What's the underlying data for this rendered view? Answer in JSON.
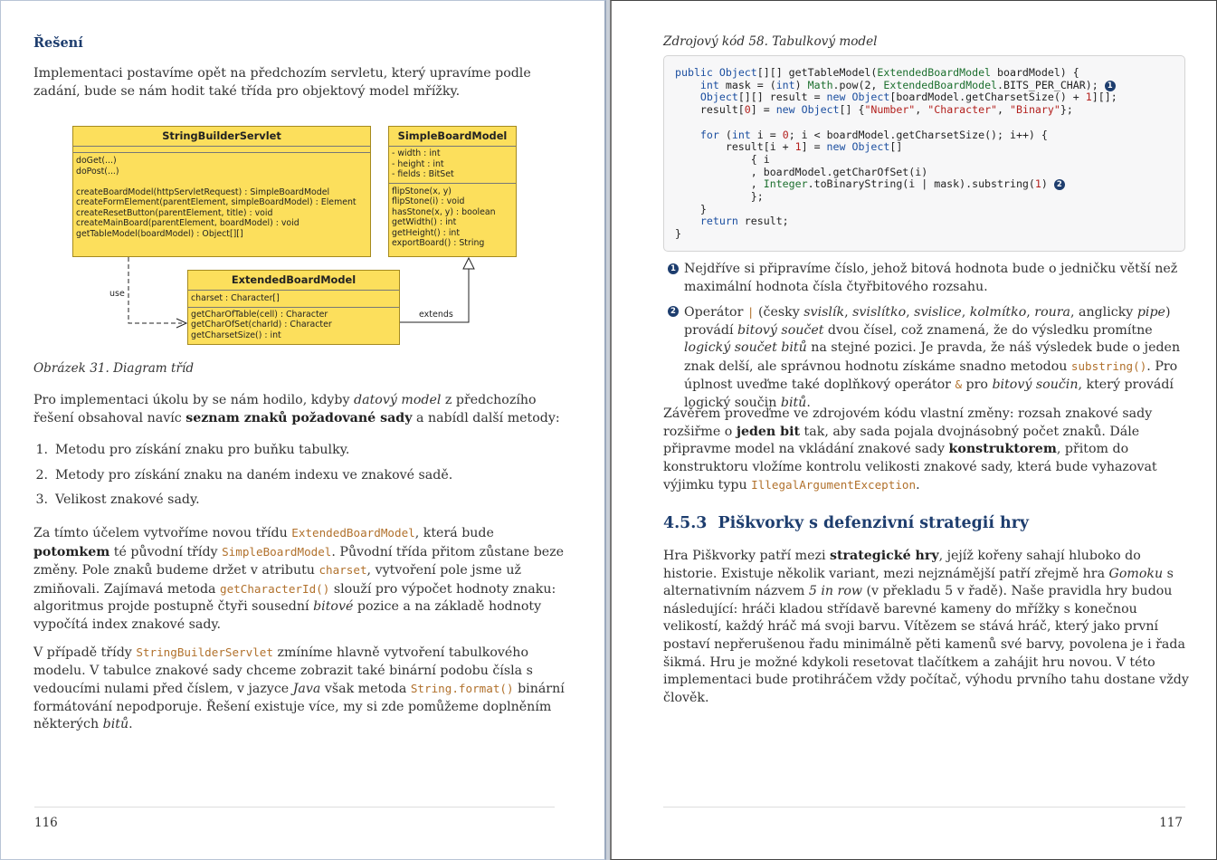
{
  "left_page": {
    "heading": "Řešení",
    "intro": "Implementaci postavíme opět na předchozím servletu, který upravíme podle zadání, bude se nám hodit také třída pro objektový model mřížky.",
    "diagram": {
      "string_builder_servlet": {
        "name": "StringBuilderServlet",
        "fields": [],
        "methods_a": [
          "doGet(...)",
          "doPost(...)"
        ],
        "methods_b": [
          "createBoardModel(httpServletRequest) : SimpleBoardModel",
          "createFormElement(parentElement, simpleBoardModel) : Element",
          "createResetButton(parentElement, title) : void",
          "createMainBoard(parentElement, boardModel) : void",
          "getTableModel(boardModel) : Object[][]"
        ]
      },
      "simple_board_model": {
        "name": "SimpleBoardModel",
        "fields": [
          "- width : int",
          "- height : int",
          "- fields : BitSet"
        ],
        "methods": [
          "flipStone(x, y)",
          "flipStone(i) : void",
          "hasStone(x, y) : boolean",
          "getWidth() : int",
          "getHeight() : int",
          "exportBoard() : String"
        ]
      },
      "extended_board_model": {
        "name": "ExtendedBoardModel",
        "fields": [
          "charset : Character[]"
        ],
        "methods": [
          "getCharOfTable(cell) : Character",
          "getCharOfSet(charId) : Character",
          "getCharsetSize() : int"
        ]
      },
      "use_label": "use",
      "extends_label": "extends"
    },
    "figure_caption": "Obrázek 31. Diagram tříd",
    "para2": {
      "a": "Pro implementaci úkolu by se nám hodilo, kdyby ",
      "b_italic": "datový model",
      "c": " z předchozího řešení obsahoval navíc ",
      "d_bold": "seznam znaků požadované sady",
      "e": " a nabídl další metody:"
    },
    "list": [
      {
        "num": "1.",
        "text": "Metodu pro získání znaku pro buňku tabulky."
      },
      {
        "num": "2.",
        "text": "Metody pro získání znaku na daném indexu ve znakové sadě."
      },
      {
        "num": "3.",
        "text": "Velikost znakové sady."
      }
    ],
    "para3": {
      "a": "Za tímto účelem vytvoříme novou třídu ",
      "code1": "ExtendedBoardModel",
      "b": ", která bude ",
      "bold1": "potomkem",
      "c": " té původní třídy ",
      "code2": "SimpleBoardModel",
      "d": ". Původní třída přitom zůstane beze změny. Pole znaků budeme držet v atributu ",
      "code3": "charset",
      "e": ", vytvoření pole jsme už zmiňovali. Zajímavá metoda ",
      "code4": "getCharacterId()",
      "f": " slouží pro výpočet hodnoty znaku: algoritmus projde postupně čtyři sousední ",
      "italic1": "bitové",
      "g": " pozice a na základě hodnoty vypočítá index znakové sady."
    },
    "para4": {
      "a": "V případě třídy ",
      "code1": "StringBuilderServlet",
      "b": " zmíníme hlavně vytvoření tabulkového modelu. V tabulce znakové sady chceme zobrazit také binární podobu čísla s vedoucími nulami před číslem, v jazyce ",
      "italic1": "Java",
      "c": " však metoda ",
      "code2": "String.format()",
      "d": " binární formátování nepodporuje. Řešení existuje více, my si zde pomůžeme doplněním některých ",
      "italic2": "bitů",
      "e": "."
    },
    "page_number": "116"
  },
  "right_page": {
    "code_caption": "Zdrojový kód 58. Tabulkový model",
    "code_lines": [
      "public Object[][] getTableModel(ExtendedBoardModel boardModel) {",
      "    int mask = (int) Math.pow(2, ExtendedBoardModel.BITS_PER_CHAR);",
      "    Object[][] result = new Object[boardModel.getCharsetSize() + 1][];",
      "    result[0] = new Object[] {\"Number\", \"Character\", \"Binary\"};",
      "",
      "    for (int i = 0; i < boardModel.getCharsetSize(); i++) {",
      "        result[i + 1] = new Object[]",
      "            { i",
      "            , boardModel.getCharOfSet(i)",
      "            , Integer.toBinaryString(i | mask).substring(1)",
      "            };",
      "    }",
      "    return result;",
      "}"
    ],
    "callout_1": "1",
    "callout_2": "2",
    "callout1_text": "Nejdříve si připravíme číslo, jehož bitová hodnota bude o jedničku větší než maximální hodnota čísla čtyřbitového rozsahu.",
    "callout2": {
      "a": "Operátor ",
      "op": "|",
      "b": " (česky ",
      "i1": "svislík",
      "c1": ", ",
      "i2": "svislítko",
      "c2": ", ",
      "i3": "svislice",
      "c3": ", ",
      "i4": "kolmítko",
      "c4": ", ",
      "i5": "roura",
      "c5": ", anglicky ",
      "i6": "pipe",
      "c6": ") provádí ",
      "i7": "bitový součet",
      "c7": " dvou čísel, což znamená, že do výsledku promítne ",
      "i8": "logický součet bitů",
      "c8": " na stejné pozici. Je pravda, že náš výsledek bude o jeden znak delší, ale správnou hodnotu získáme snadno metodou ",
      "code1": "substring()",
      "c9": ". Pro úplnost uveďme také doplňkový operátor ",
      "op2": "&",
      "c10": " pro ",
      "i9": "bitový součin",
      "c11": ", který provádí logický součin ",
      "i10": "bitů",
      "c12": "."
    },
    "para1": {
      "a": "Závěrem proveďme ve zdrojovém kódu vlastní změny: rozsah znakové sady rozšiřme o ",
      "bold1": "jeden bit",
      "b": " tak, aby sada pojala dvojnásobný počet znaků. Dále připravme model na vkládání znakové sady ",
      "bold2": "konstruktorem",
      "c": ", přitom do konstruktoru vložíme kontrolu velikosti znakové sady, která bude vyhazovat výjimku typu ",
      "code1": "IllegalArgumentException",
      "d": "."
    },
    "section_heading": "4.5.3  Piškvorky s defenzivní strategií hry",
    "para2": {
      "a": "Hra Piškvorky patří mezi ",
      "bold1": "strategické hry",
      "b": ", jejíž kořeny sahají hluboko do historie. Existuje několik variant, mezi nejznámější patří zřejmě hra ",
      "italic1": "Gomoku",
      "c": " s alternativním názvem ",
      "italic2": "5 in row",
      "d": " (v překladu 5 v řadě). Naše pravidla hry budou následující: hráči kladou střídavě barevné kameny do mřížky s konečnou velikostí, každý hráč má svoji barvu. Vítězem se stává hráč, který jako první postaví nepřerušenou řadu minimálně pěti kamenů své barvy, povolena je i řada šikmá. Hru je možné kdykoli resetovat tlačítkem a zahájit hru novou. V této implementaci bude protihráčem vždy počítač, výhodu prvního tahu dostane vždy člověk."
    },
    "page_number": "117"
  },
  "colors": {
    "heading": "#1d3d6e",
    "uml_fill": "#fcdf5c",
    "inline_code": "#b1712c",
    "code_keyword": "#1c4fa0",
    "code_string": "#b3201d"
  }
}
